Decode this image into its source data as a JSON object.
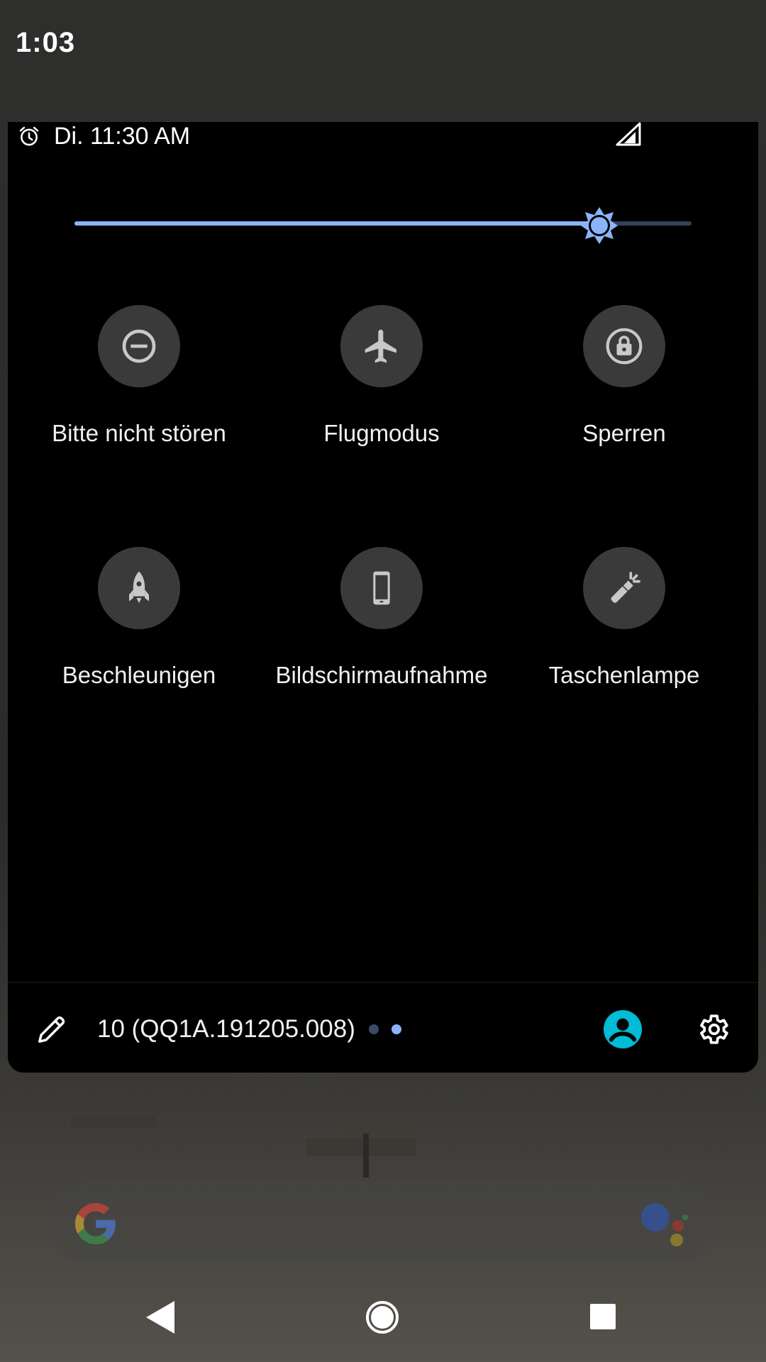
{
  "status_bar": {
    "time": "1:03"
  },
  "header": {
    "alarm_text": "Di. 11:30 AM"
  },
  "brightness": {
    "level": 0.85,
    "accent_color": "#8ab4f8"
  },
  "tiles": [
    {
      "label": "Bitte nicht stören",
      "icon": "do-not-disturb-icon"
    },
    {
      "label": "Flugmodus",
      "icon": "airplane-icon"
    },
    {
      "label": "Sperren",
      "icon": "lock-icon"
    },
    {
      "label": "Beschleunigen",
      "icon": "rocket-icon"
    },
    {
      "label": "Bildschirmaufnahme",
      "icon": "phone-screen-icon"
    },
    {
      "label": "Taschenlampe",
      "icon": "flashlight-icon"
    }
  ],
  "footer": {
    "build_number": "10 (QQ1A.191205.008)",
    "page_count": 2,
    "active_page": 2,
    "user_color": "#00bcd4"
  },
  "colors": {
    "panel": "#000000",
    "tile_background": "#3a3a3a",
    "tile_icon": "#c8c8c8"
  }
}
